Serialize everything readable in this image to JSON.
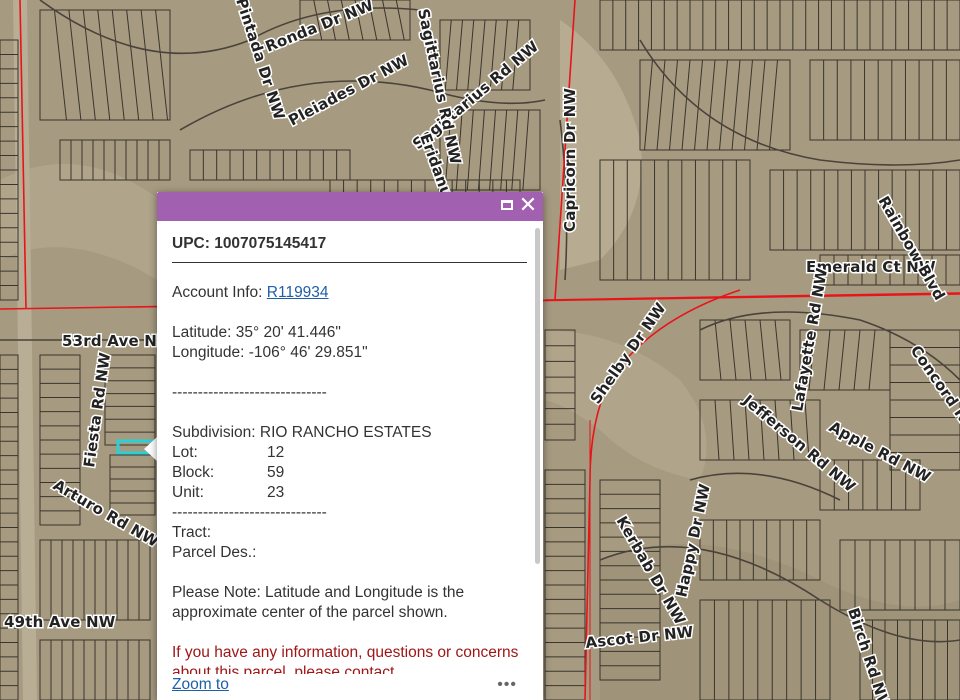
{
  "map": {
    "road_labels": {
      "ronda": "Ronda Dr NW",
      "pintada": "Pintada Dr NW",
      "pleiades": "Pleiades Dr NW",
      "sagittarius": "Sagittarius Rd NW",
      "sagittarius2": "Sagittarius Rd NW",
      "capricorn": "Capricorn Dr NW",
      "eridanus": "Eridanus Rd NW",
      "emerald": "Emerald Ct NW",
      "rainbow": "Rainbow Blvd",
      "shelby": "Shelby Dr NW",
      "ave53": "53rd Ave NW",
      "ave49": "49th Ave NW",
      "fiesta": "Fiesta Rd NW",
      "arturo": "Arturo Rd NW",
      "jefferson": "Jefferson Rd NW",
      "lafayette": "Lafayette Rd NW",
      "apple": "Apple Rd NW",
      "concord": "Concord Rd NW",
      "happy": "Happy Dr NW",
      "kerbab": "Kerbab Dr NW",
      "ascot": "Ascot Dr NW",
      "birch": "Birch Rd NW"
    },
    "colors": {
      "ground": "#a69a80",
      "parcel_lines": "#3a342c",
      "boundary": "#e8141a",
      "highlight": "#29d0d8"
    }
  },
  "popup": {
    "header_color": "#a260b1",
    "maximize_icon": "maximize-icon",
    "close_icon": "close-icon",
    "close_glyph": "✕",
    "upc": "UPC: 1007075145417",
    "account_label": "Account Info: ",
    "account_link": "R119934",
    "latitude": "Latitude: 35° 20' 41.446\"",
    "longitude": "Longitude: -106° 46' 29.851\"",
    "divider": "------------------------------",
    "subdivision": "Subdivision: RIO RANCHO ESTATES",
    "lot_label": "Lot:",
    "lot_value": "12",
    "block_label": "Block:",
    "block_value": "59",
    "unit_label": "Unit:",
    "unit_value": "23",
    "tract_label": "Tract:",
    "parcel_des_label": "Parcel Des.:",
    "note": "Please Note: Latitude and Longitude is the approximate center of the parcel shown.",
    "contact_note": "If you have any information, questions or concerns about this parcel, please contact",
    "zoom_link": "Zoom to",
    "more_glyph": "•••"
  }
}
